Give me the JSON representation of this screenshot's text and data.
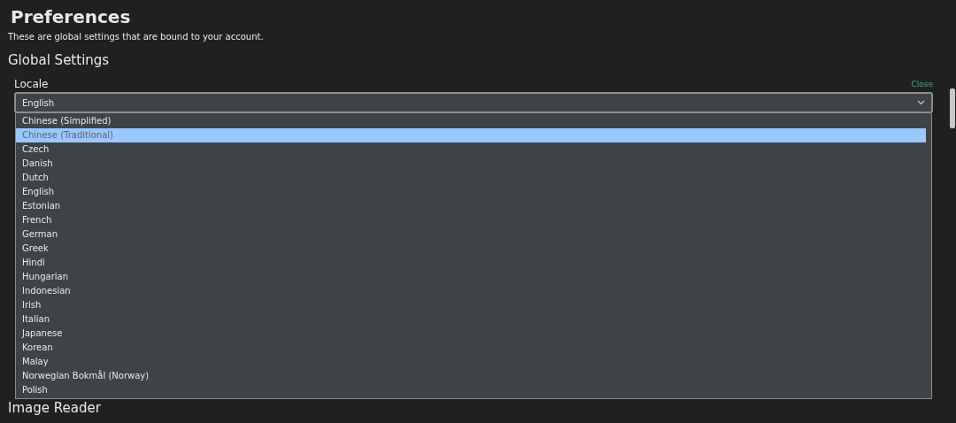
{
  "page": {
    "title": "Preferences",
    "subtitle": "These are global settings that are bound to your account."
  },
  "section": {
    "title": "Global Settings"
  },
  "locale": {
    "label": "Locale",
    "close": "Close",
    "value": "English",
    "expanded": true,
    "options": [
      {
        "label": "Chinese (Simplified)",
        "highlighted": false
      },
      {
        "label": "Chinese (Traditional)",
        "highlighted": true
      },
      {
        "label": "Czech",
        "highlighted": false
      },
      {
        "label": "Danish",
        "highlighted": false
      },
      {
        "label": "Dutch",
        "highlighted": false
      },
      {
        "label": "English",
        "highlighted": false
      },
      {
        "label": "Estonian",
        "highlighted": false
      },
      {
        "label": "French",
        "highlighted": false
      },
      {
        "label": "German",
        "highlighted": false
      },
      {
        "label": "Greek",
        "highlighted": false
      },
      {
        "label": "Hindi",
        "highlighted": false
      },
      {
        "label": "Hungarian",
        "highlighted": false
      },
      {
        "label": "Indonesian",
        "highlighted": false
      },
      {
        "label": "Irish",
        "highlighted": false
      },
      {
        "label": "Italian",
        "highlighted": false
      },
      {
        "label": "Japanese",
        "highlighted": false
      },
      {
        "label": "Korean",
        "highlighted": false
      },
      {
        "label": "Malay",
        "highlighted": false
      },
      {
        "label": "Norwegian Bokmål (Norway)",
        "highlighted": false
      },
      {
        "label": "Polish",
        "highlighted": false
      }
    ]
  },
  "next_section": {
    "title": "Image Reader"
  }
}
